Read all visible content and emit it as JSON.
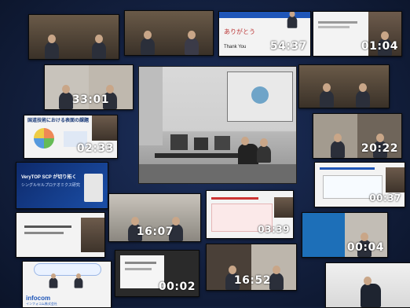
{
  "tiles": [
    {
      "id": "t1",
      "duration": ""
    },
    {
      "id": "t2",
      "duration": ""
    },
    {
      "id": "t3",
      "duration": "54:37",
      "slide_text": "ありがとう",
      "slide_sub": "Thank You"
    },
    {
      "id": "t4",
      "duration": "01:04"
    },
    {
      "id": "t5",
      "duration": "33:01"
    },
    {
      "id": "t6",
      "duration": ""
    },
    {
      "id": "t7",
      "duration": "02:33",
      "slide_text": "国道技術における表面の課題"
    },
    {
      "id": "t8",
      "duration": "20:22"
    },
    {
      "id": "t9",
      "duration": "",
      "slide_title": "VeryTOP SCP が切り拓く",
      "slide_sub": "シングルセルプロテオミクス研究"
    },
    {
      "id": "t10",
      "duration": "00:37"
    },
    {
      "id": "t11",
      "duration": "16:07"
    },
    {
      "id": "t12",
      "duration": "03:39"
    },
    {
      "id": "t13",
      "duration": ""
    },
    {
      "id": "t14",
      "duration": "00:04"
    },
    {
      "id": "t15",
      "duration": "",
      "slide_text": "インフォコム株式会社",
      "brand": "infocom"
    },
    {
      "id": "t16",
      "duration": "00:02"
    },
    {
      "id": "t17",
      "duration": "16:52"
    },
    {
      "id": "t18",
      "duration": ""
    }
  ]
}
